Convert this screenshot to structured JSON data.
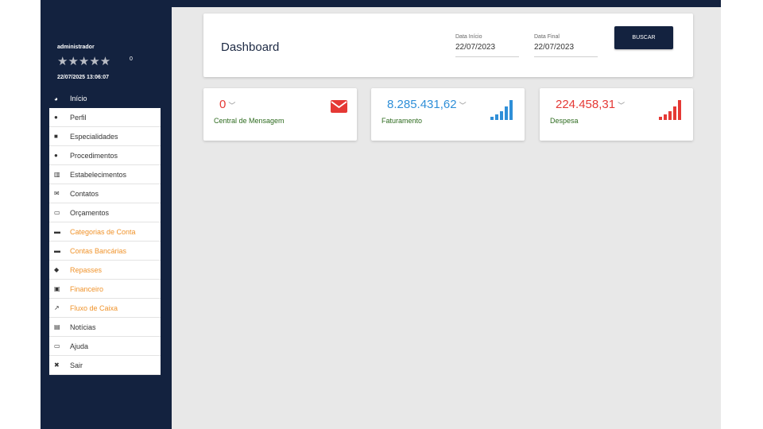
{
  "user": {
    "name": "administrador",
    "stars": "★★★★★",
    "rating_count": "0",
    "datetime": "22/07/2025 13:06:07"
  },
  "menu": [
    {
      "label": "Início",
      "icon": "pie-chart-icon",
      "glyph": "◕",
      "state": "active"
    },
    {
      "label": "Perfil",
      "icon": "user-icon",
      "glyph": "●",
      "state": "normal"
    },
    {
      "label": "Especialidades",
      "icon": "book-icon",
      "glyph": "■",
      "state": "normal"
    },
    {
      "label": "Procedimentos",
      "icon": "users-icon",
      "glyph": "●",
      "state": "normal"
    },
    {
      "label": "Estabelecimentos",
      "icon": "map-icon",
      "glyph": "▥",
      "state": "normal"
    },
    {
      "label": "Contatos",
      "icon": "envelope-icon",
      "glyph": "✉",
      "state": "normal"
    },
    {
      "label": "Orçamentos",
      "icon": "money-icon",
      "glyph": "▭",
      "state": "normal"
    },
    {
      "label": "Categorias de Conta",
      "icon": "folder-icon",
      "glyph": "▬",
      "state": "orange"
    },
    {
      "label": "Contas Bancárias",
      "icon": "folder-icon",
      "glyph": "▬",
      "state": "orange"
    },
    {
      "label": "Repasses",
      "icon": "handshake-icon",
      "glyph": "◆",
      "state": "orange"
    },
    {
      "label": "Financeiro",
      "icon": "money-bill-icon",
      "glyph": "▣",
      "state": "orange"
    },
    {
      "label": "Fluxo de Caixa",
      "icon": "line-chart-icon",
      "glyph": "↗",
      "state": "orange"
    },
    {
      "label": "Notícias",
      "icon": "newspaper-icon",
      "glyph": "▤",
      "state": "normal"
    },
    {
      "label": "Ajuda",
      "icon": "monitor-icon",
      "glyph": "▭",
      "state": "normal"
    },
    {
      "label": "Sair",
      "icon": "close-icon",
      "glyph": "✖",
      "state": "normal"
    }
  ],
  "header": {
    "title": "Dashboard",
    "date_start_label": "Data Início",
    "date_start": "22/07/2023",
    "date_end_label": "Data Final",
    "date_end": "22/07/2023",
    "search_button": "BUSCAR"
  },
  "cards": {
    "messages": {
      "value": "0",
      "label": "Central de Mensagem",
      "value_color": "#e53935",
      "label_color": "#2e6b1f",
      "icon": "envelope-icon"
    },
    "revenue": {
      "value": "8.285.431,62",
      "label": "Faturamento",
      "value_color": "#2f8fd8",
      "label_color": "#2e6b1f",
      "icon": "signal-bars-icon"
    },
    "expense": {
      "value": "224.458,31",
      "label": "Despesa",
      "value_color": "#e53935",
      "label_color": "#2e6b1f",
      "icon": "signal-bars-icon"
    }
  },
  "colors": {
    "navy": "#13223f",
    "orange": "#f0932b",
    "blue": "#2f8fd8",
    "red": "#e53935"
  }
}
